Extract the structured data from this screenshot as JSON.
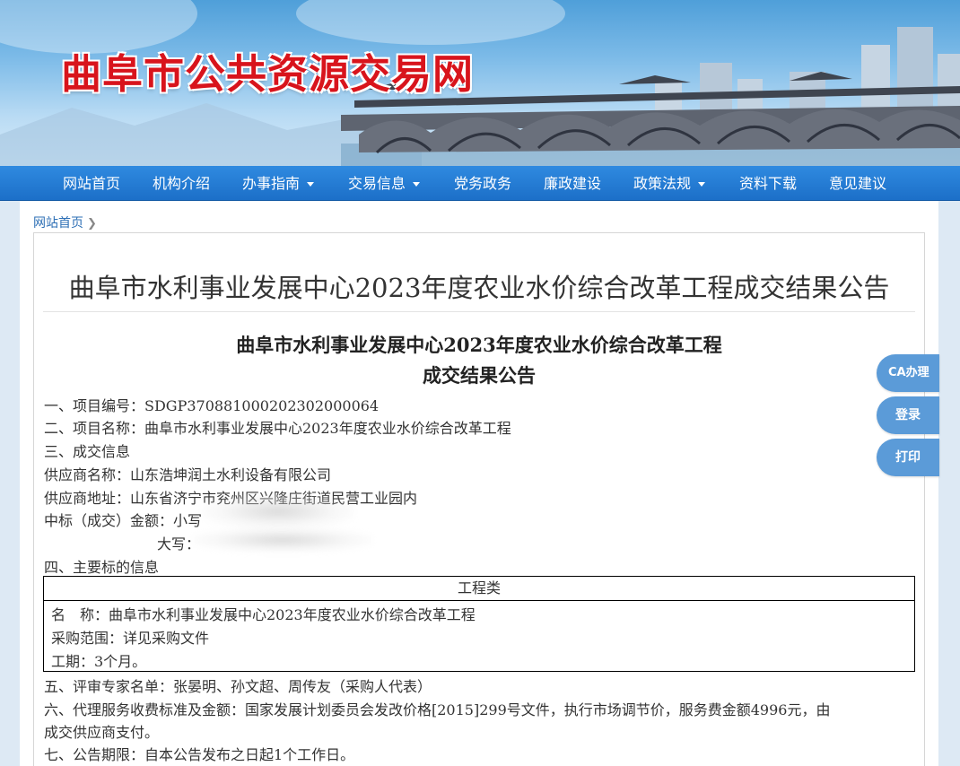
{
  "site": {
    "title": "曲阜市公共资源交易网"
  },
  "nav": {
    "items": [
      {
        "label": "网站首页",
        "dropdown": false
      },
      {
        "label": "机构介绍",
        "dropdown": false
      },
      {
        "label": "办事指南",
        "dropdown": true
      },
      {
        "label": "交易信息",
        "dropdown": true
      },
      {
        "label": "党务政务",
        "dropdown": false
      },
      {
        "label": "廉政建设",
        "dropdown": false
      },
      {
        "label": "政策法规",
        "dropdown": true
      },
      {
        "label": "资料下载",
        "dropdown": false
      },
      {
        "label": "意见建议",
        "dropdown": false
      }
    ]
  },
  "breadcrumb": {
    "home": "网站首页",
    "separator_icon": "chevron-right-icon"
  },
  "article": {
    "title": "曲阜市水利事业发展中心2023年度农业水价综合改革工程成交结果公告",
    "heading_line1": "曲阜市水利事业发展中心2023年度农业水价综合改革工程",
    "heading_line2": "成交结果公告",
    "project_no": "一、项目编号：SDGP370881000202302000064",
    "project_name": "二、项目名称：曲阜市水利事业发展中心2023年度农业水价综合改革工程",
    "deal_info": "三、成交信息",
    "supplier_name": "供应商名称：山东浩坤润土水利设备有限公司",
    "supplier_addr": "供应商地址：山东省济宁市兖州区兴隆庄街道民营工业园内",
    "amount_small": "中标（成交）金额：小写",
    "amount_big": "大写：",
    "main_subject": "四、主要标的信息",
    "table": {
      "header": "工程类",
      "name": "名　称：曲阜市水利事业发展中心2023年度农业水价综合改革工程",
      "scope": "采购范围：详见采购文件",
      "period": "工期：3个月。"
    },
    "experts": "五、评审专家名单：张晏明、孙文超、周传友（采购人代表）",
    "fee_line1": "六、代理服务收费标准及金额：国家发展计划委员会发改价格[2015]299号文件，执行市场调节价，服务费金额4996元，由",
    "fee_line2": "成交供应商支付。",
    "notice_period": "七、公告期限：自本公告发布之日起1个工作日。"
  },
  "side_buttons": {
    "ca": "CA办理",
    "login": "登录",
    "print": "打印"
  },
  "colors": {
    "nav": "#1c6fc8",
    "title_red": "#d8141c",
    "side_button": "#5b9bd8",
    "link": "#2d6fb5"
  }
}
